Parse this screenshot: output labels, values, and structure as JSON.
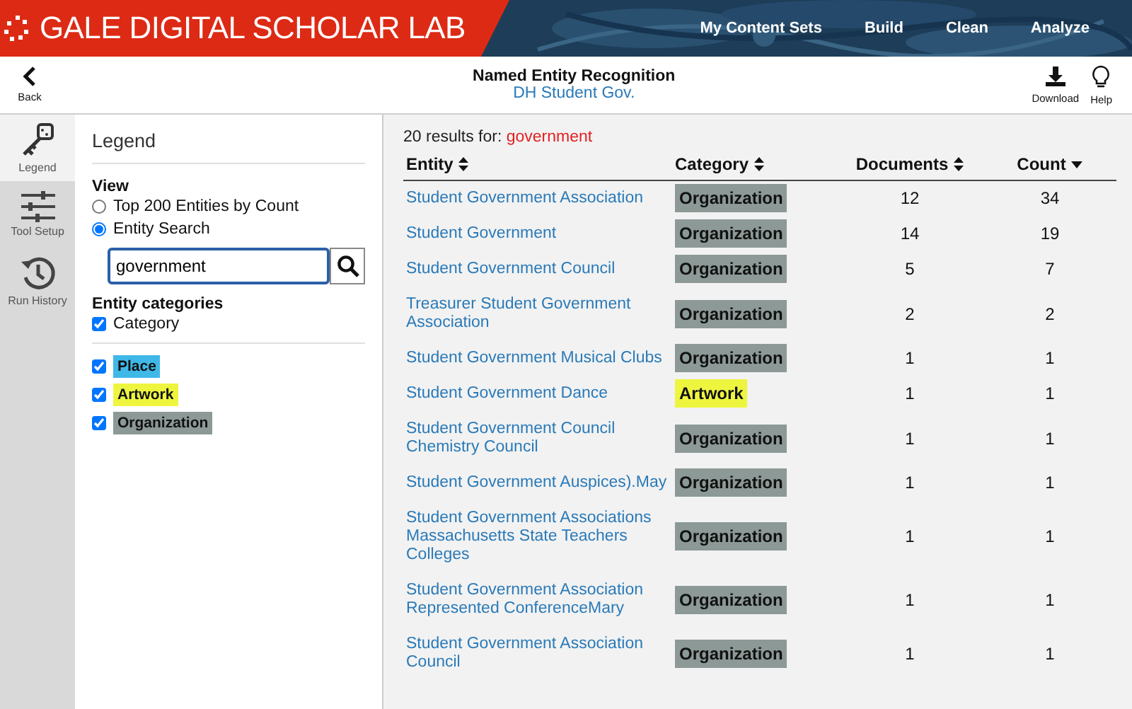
{
  "header": {
    "logo_text": "GALE DIGITAL SCHOLAR LAB",
    "nav": [
      "My Content Sets",
      "Build",
      "Clean",
      "Analyze"
    ]
  },
  "toolbar": {
    "back": "Back",
    "title": "Named Entity Recognition",
    "subtitle": "DH Student Gov.",
    "actions": [
      {
        "label": "Download",
        "kind": "download"
      },
      {
        "label": "Help",
        "kind": "help"
      }
    ]
  },
  "rail": [
    {
      "label": "Legend",
      "kind": "legend",
      "selected": true
    },
    {
      "label": "Tool Setup",
      "kind": "setup",
      "selected": false
    },
    {
      "label": "Run History",
      "kind": "history",
      "selected": false
    }
  ],
  "legend": {
    "title": "Legend",
    "view_heading": "View",
    "view_options": [
      {
        "label": "Top 200 Entities by Count",
        "selected": false
      },
      {
        "label": "Entity Search",
        "selected": true
      }
    ],
    "search": {
      "value": "government"
    },
    "categories_heading": "Entity categories",
    "all": {
      "label": "Category",
      "checked": true
    },
    "categories": [
      {
        "label": "Place",
        "checked": true,
        "color": "#3fb8e8"
      },
      {
        "label": "Artwork",
        "checked": true,
        "color": "#eef53f"
      },
      {
        "label": "Organization",
        "checked": true,
        "color": "#8c9996"
      }
    ]
  },
  "results": {
    "count_text": "20 results for:",
    "query": "government",
    "columns": [
      {
        "label": "Entity",
        "sorted": false
      },
      {
        "label": "Category",
        "sorted": false
      },
      {
        "label": "Documents",
        "sorted": false
      },
      {
        "label": "Count",
        "sorted": true
      }
    ],
    "rows": [
      {
        "entity": "Student Government Association",
        "category": "Organization",
        "color": "#8c9996",
        "documents": "12",
        "count": "34"
      },
      {
        "entity": "Student Government",
        "category": "Organization",
        "color": "#8c9996",
        "documents": "14",
        "count": "19"
      },
      {
        "entity": "Student Government Council",
        "category": "Organization",
        "color": "#8c9996",
        "documents": "5",
        "count": "7"
      },
      {
        "entity": "Treasurer Student Government Association",
        "category": "Organization",
        "color": "#8c9996",
        "documents": "2",
        "count": "2"
      },
      {
        "entity": "Student Government Musical Clubs",
        "category": "Organization",
        "color": "#8c9996",
        "documents": "1",
        "count": "1"
      },
      {
        "entity": "Student Government Dance",
        "category": "Artwork",
        "color": "#eef53f",
        "documents": "1",
        "count": "1"
      },
      {
        "entity": "Student Government Council Chemistry Council",
        "category": "Organization",
        "color": "#8c9996",
        "documents": "1",
        "count": "1"
      },
      {
        "entity": "Student Government Auspices).May",
        "category": "Organization",
        "color": "#8c9996",
        "documents": "1",
        "count": "1"
      },
      {
        "entity": "Student Government Associations Massachusetts State Teachers Colleges",
        "category": "Organization",
        "color": "#8c9996",
        "documents": "1",
        "count": "1"
      },
      {
        "entity": "Student Government Association Represented ConferenceMary",
        "category": "Organization",
        "color": "#8c9996",
        "documents": "1",
        "count": "1"
      },
      {
        "entity": "Student Government Association Council",
        "category": "Organization",
        "color": "#8c9996",
        "documents": "1",
        "count": "1"
      }
    ]
  }
}
